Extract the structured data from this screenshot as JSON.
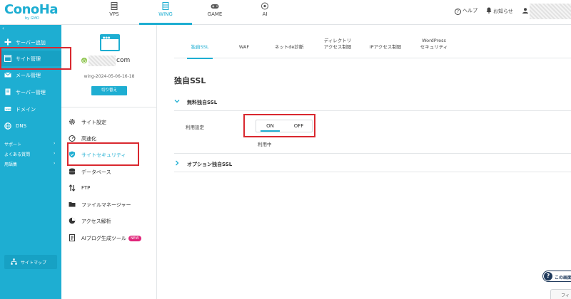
{
  "brand": {
    "logo_text": "ConoHa",
    "logo_sub": "by GMO"
  },
  "top_nav": {
    "tabs": [
      {
        "label": "VPS",
        "icon": "server-icon"
      },
      {
        "label": "WING",
        "icon": "wing-server-icon",
        "active": true
      },
      {
        "label": "GAME",
        "icon": "gamepad-icon"
      },
      {
        "label": "AI",
        "icon": "ai-chip-icon"
      }
    ],
    "help_label": "ヘルプ",
    "notice_label": "お知らせ"
  },
  "sidebar": {
    "collapse_glyph": "‹",
    "items": [
      {
        "label": "サーバー追加",
        "icon": "plus-icon"
      },
      {
        "label": "サイト管理",
        "icon": "site-window-icon",
        "selected": true
      },
      {
        "label": "メール管理",
        "icon": "mail-icon"
      },
      {
        "label": "サーバー管理",
        "icon": "server-manage-icon"
      },
      {
        "label": "ドメイン",
        "icon": "domain-icon"
      },
      {
        "label": "DNS",
        "icon": "globe-icon"
      }
    ],
    "links": [
      {
        "label": "サポート"
      },
      {
        "label": "よくある質問"
      },
      {
        "label": "用語集"
      }
    ],
    "sitemap_label": "サイトマップ"
  },
  "site_panel": {
    "domain_suffix": "com",
    "server_name": "wing-2024-05-06-16-18",
    "switch_label": "切り替え",
    "menu": [
      {
        "label": "サイト設定",
        "icon": "gear-icon"
      },
      {
        "label": "高速化",
        "icon": "speedometer-icon"
      },
      {
        "label": "サイトセキュリティ",
        "icon": "shield-check-icon",
        "active": true
      },
      {
        "label": "データベース",
        "icon": "database-icon"
      },
      {
        "label": "FTP",
        "icon": "ftp-arrows-icon"
      },
      {
        "label": "ファイルマネージャー",
        "icon": "folder-icon"
      },
      {
        "label": "アクセス解析",
        "icon": "pie-chart-icon"
      },
      {
        "label": "AIブログ生成ツール",
        "icon": "ai-doc-icon",
        "badge": "NEW"
      }
    ]
  },
  "content": {
    "tabs": [
      {
        "line1": "独自SSL",
        "line2": "",
        "active": true
      },
      {
        "line1": "WAF",
        "line2": ""
      },
      {
        "line1": "ネットde診断",
        "line2": ""
      },
      {
        "line1": "ディレクトリ",
        "line2": "アクセス制限"
      },
      {
        "line1": "IPアクセス制限",
        "line2": ""
      },
      {
        "line1": "WordPress",
        "line2": "セキュリティ"
      }
    ],
    "title": "独自SSL",
    "free_ssl_heading": "無料独自SSL",
    "usage_label": "利用設定",
    "toggle": {
      "on": "ON",
      "off": "OFF",
      "selected": "ON"
    },
    "status": "利用中",
    "option_ssl_heading": "オプション独自SSL"
  },
  "help_float_label": "この画面",
  "bottom_button_label": "フィ",
  "colors": {
    "accent": "#1eaed2",
    "highlight": "#d9282f",
    "new_badge": "#e0257a"
  }
}
